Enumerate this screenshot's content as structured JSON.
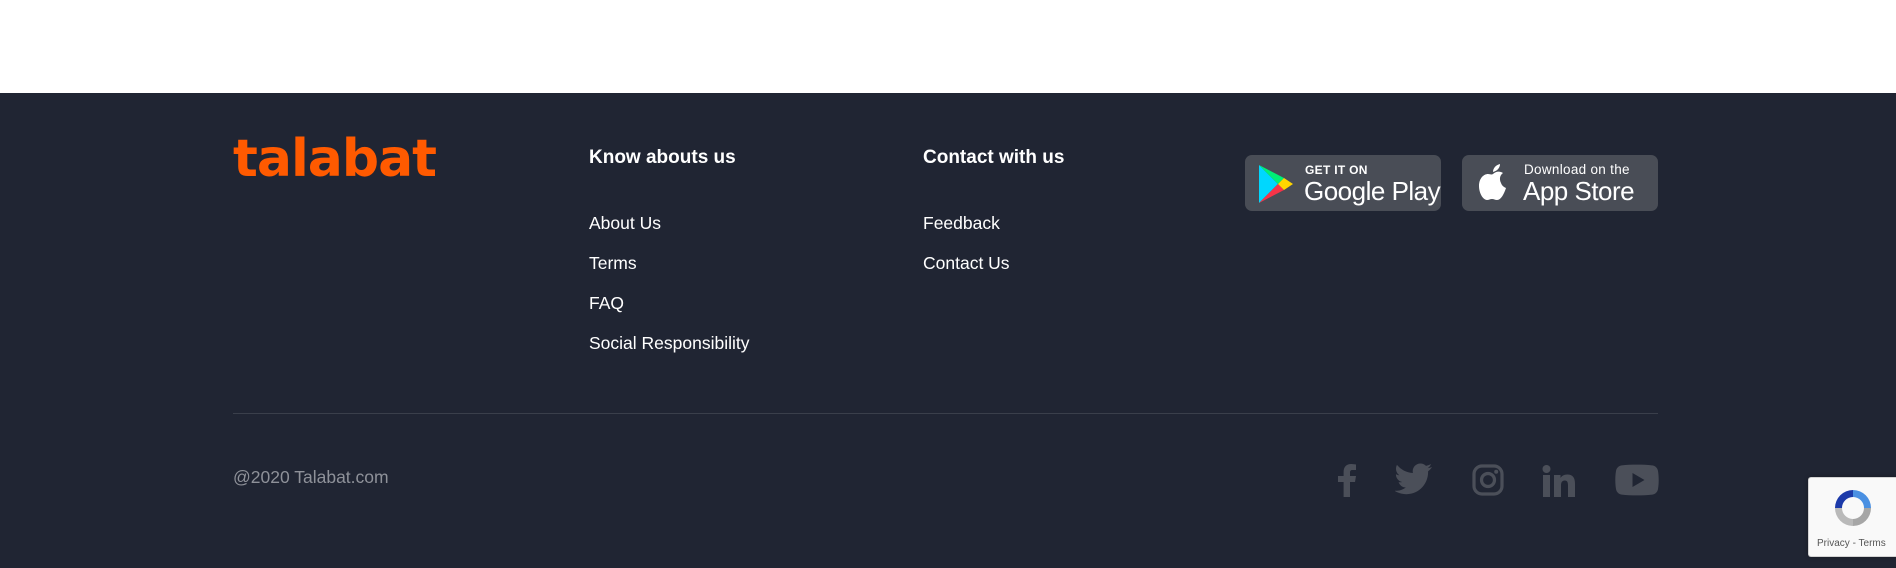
{
  "brand": {
    "logo_text": "talabat",
    "color": "#ff5a00"
  },
  "footer": {
    "background": "#202533",
    "know_about": {
      "heading": "Know abouts us",
      "links": [
        "About Us",
        "Terms",
        "FAQ",
        "Social Responsibility"
      ]
    },
    "contact": {
      "heading": "Contact with us",
      "links": [
        "Feedback",
        "Contact Us"
      ]
    },
    "apps": {
      "google_play": {
        "small": "GET IT ON",
        "big": "Google Play"
      },
      "app_store": {
        "small": "Download on the",
        "big": "App Store"
      }
    },
    "copyright": "@2020 Talabat.com",
    "social_icons": [
      "facebook-icon",
      "twitter-icon",
      "instagram-icon",
      "linkedin-icon",
      "youtube-icon"
    ]
  },
  "recaptcha": {
    "privacy": "Privacy",
    "separator": " - ",
    "terms": "Terms"
  }
}
